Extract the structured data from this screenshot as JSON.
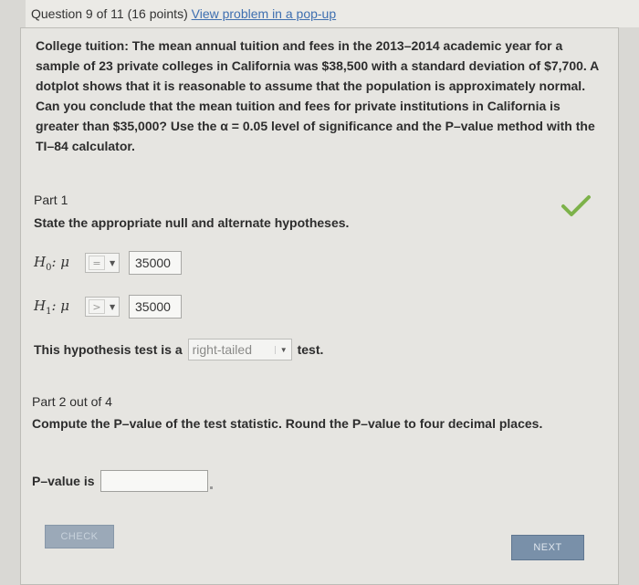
{
  "header": {
    "question_label": "Question 9 of 11 (16 points)",
    "popup_link": "View problem in a pop-up"
  },
  "problem": {
    "text": "College tuition: The mean annual tuition and fees in the 2013–2014 academic year for a sample of 23 private colleges in California was $38,500 with a standard deviation of $7,700. A dotplot shows that it is reasonable to assume that the population is approximately normal. Can you conclude that the mean tuition and fees for private institutions in California is greater than $35,000? Use the α = 0.05 level of significance and the P–value method with the TI–84 calculator."
  },
  "part1": {
    "label": "Part 1",
    "instruction": "State the appropriate null and alternate hypotheses.",
    "status": "correct",
    "h0": {
      "symbol": "H",
      "subscript": "0",
      "param": ": μ",
      "operator": "=",
      "value": "35000"
    },
    "h1": {
      "symbol": "H",
      "subscript": "1",
      "param": ": μ",
      "operator": ">",
      "value": "35000"
    },
    "tail_prefix": "This hypothesis test is a",
    "tail_value": "right-tailed",
    "tail_suffix": "test."
  },
  "part2": {
    "label": "Part 2 out of 4",
    "instruction": "Compute the P–value of the test statistic. Round the P–value to four decimal places.",
    "pvalue_label": "P–value is",
    "pvalue_input": ""
  },
  "buttons": {
    "check": "CHECK",
    "next": "NEXT"
  },
  "colors": {
    "accent_check": "#7db24a",
    "link": "#3e6fb0",
    "next_button": "#7990a9"
  }
}
